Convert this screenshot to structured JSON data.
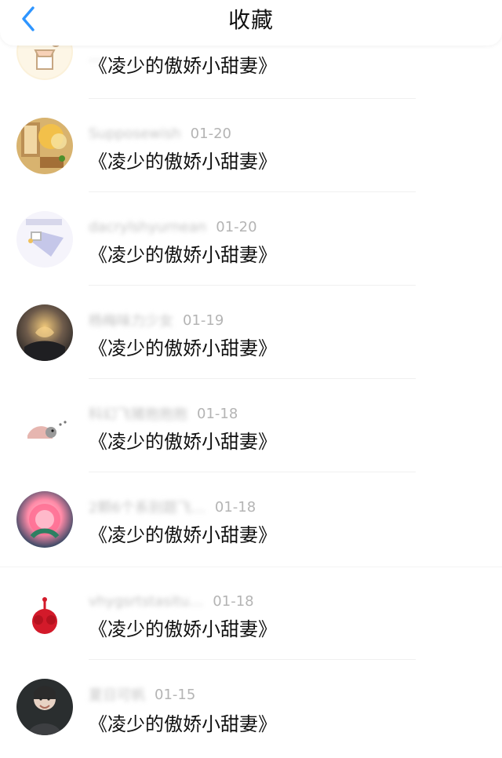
{
  "header": {
    "title": "收藏",
    "back_icon": "chevron-left-icon"
  },
  "items": [
    {
      "name": "…",
      "date": "",
      "text": "《凌少的傲娇小甜妻》"
    },
    {
      "name": "Supposewish",
      "date": "01-20",
      "text": "《凌少的傲娇小甜妻》"
    },
    {
      "name": "dacrylshyurnean",
      "date": "01-20",
      "text": "《凌少的傲娇小甜妻》"
    },
    {
      "name": "杨梅味力少女",
      "date": "01-19",
      "text": "《凌少的傲娇小甜妻》"
    },
    {
      "name": "科幻飞猪抱抱抱",
      "date": "01-18",
      "text": "《凌少的傲娇小甜妻》"
    },
    {
      "name": "2颗6个系别题飞…",
      "date": "01-18",
      "text": "《凌少的傲娇小甜妻》"
    },
    {
      "name": "vhygsrtstasitu…",
      "date": "01-18",
      "text": "《凌少的傲娇小甜妻》"
    },
    {
      "name": "夏日可帆",
      "date": "01-15",
      "text": "《凌少的傲娇小甜妻》"
    }
  ],
  "colors": {
    "accent": "#2e95ff",
    "title": "#111111",
    "meta": "#b4b4b4",
    "divider": "#f0f0f0"
  }
}
